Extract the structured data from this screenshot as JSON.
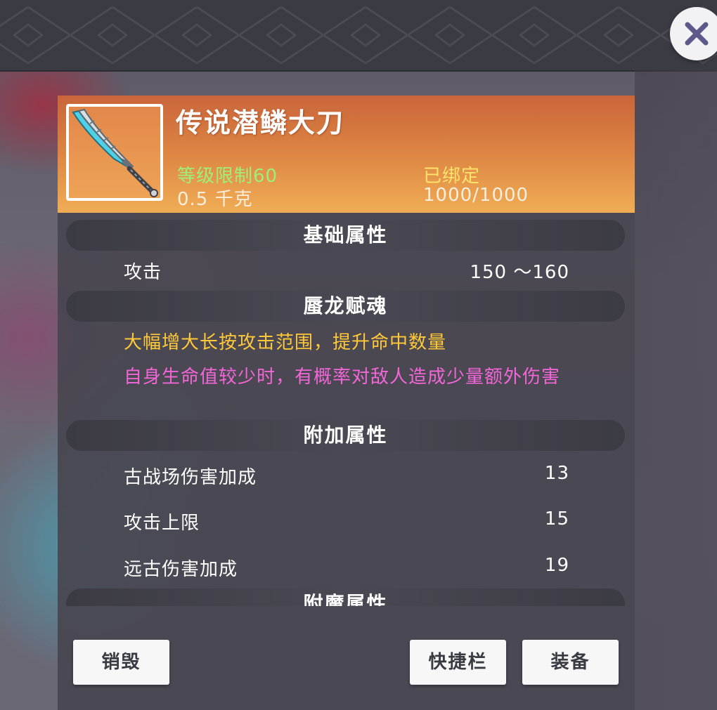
{
  "close": {
    "icon": "close-icon"
  },
  "item": {
    "name": "传说潜鳞大刀",
    "icon": "broadsword-icon",
    "level_requirement": "等级限制60",
    "bound_status": "已绑定",
    "weight": "0.5 千克",
    "durability": "1000/1000"
  },
  "sections": {
    "basic": {
      "title": "基础属性",
      "attributes": [
        {
          "label": "攻击",
          "value": "150 ～160"
        }
      ]
    },
    "soul": {
      "title": "蜃龙赋魂",
      "effects": [
        {
          "text": "大幅增大长按攻击范围，提升命中数量",
          "color": "#ffc93a"
        },
        {
          "text": "自身生命值较少时，有概率对敌人造成少量额外伤害",
          "color": "#f266d8"
        }
      ]
    },
    "extra": {
      "title": "附加属性",
      "attributes": [
        {
          "label": "古战场伤害加成",
          "value": "13"
        },
        {
          "label": "攻击上限",
          "value": "15"
        },
        {
          "label": "远古伤害加成",
          "value": "19"
        }
      ]
    },
    "enchant": {
      "title": "附魔属性"
    }
  },
  "buttons": {
    "destroy": "销毁",
    "hotbar": "快捷栏",
    "equip": "装备"
  },
  "colors": {
    "header_top": "#c9653a",
    "header_bottom": "#f0ad55",
    "level_text": "#9cf07a",
    "bound_text": "#ffe36a",
    "effect_gold": "#ffc93a",
    "effect_pink": "#f266d8"
  }
}
